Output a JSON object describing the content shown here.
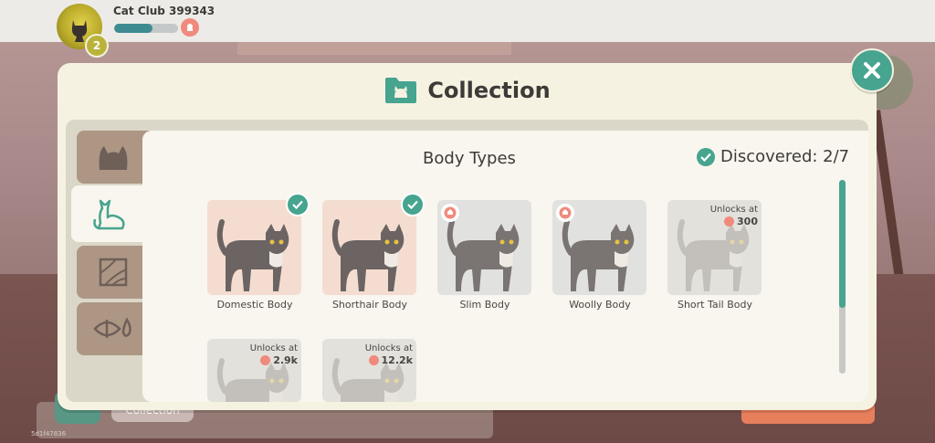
{
  "header": {
    "club_name": "Cat Club 399343",
    "level": "2",
    "xp_progress": 0.6
  },
  "modal": {
    "title": "Collection",
    "close_icon": "close-x-icon",
    "title_icon": "cat-folder-icon"
  },
  "tabs": [
    {
      "name": "cat-face",
      "icon": "cat-face-icon",
      "active": false
    },
    {
      "name": "body",
      "icon": "cat-body-icon",
      "active": true
    },
    {
      "name": "pattern",
      "icon": "pattern-icon",
      "active": false
    },
    {
      "name": "eyes",
      "icon": "eye-icon",
      "active": false
    }
  ],
  "section": {
    "title": "Body Types",
    "discovered_label": "Discovered: 2/7"
  },
  "cards": [
    {
      "label": "Domestic Body",
      "status": "owned"
    },
    {
      "label": "Shorthair Body",
      "status": "owned"
    },
    {
      "label": "Slim Body",
      "status": "available"
    },
    {
      "label": "Woolly Body",
      "status": "available"
    },
    {
      "label": "Short Tail Body",
      "status": "locked",
      "unlock_text": "Unlocks at",
      "unlock_cost": "300"
    },
    {
      "label": "",
      "status": "locked",
      "unlock_text": "Unlocks at",
      "unlock_cost": "2.9k"
    },
    {
      "label": "",
      "status": "locked",
      "unlock_text": "Unlocks at",
      "unlock_cost": "12.2k"
    }
  ],
  "background": {
    "collection_button": "Collection",
    "code": "5d1f47836"
  },
  "colors": {
    "accent": "#46a48f",
    "coin": "#f08a7c",
    "panel": "#f6f2e2"
  }
}
